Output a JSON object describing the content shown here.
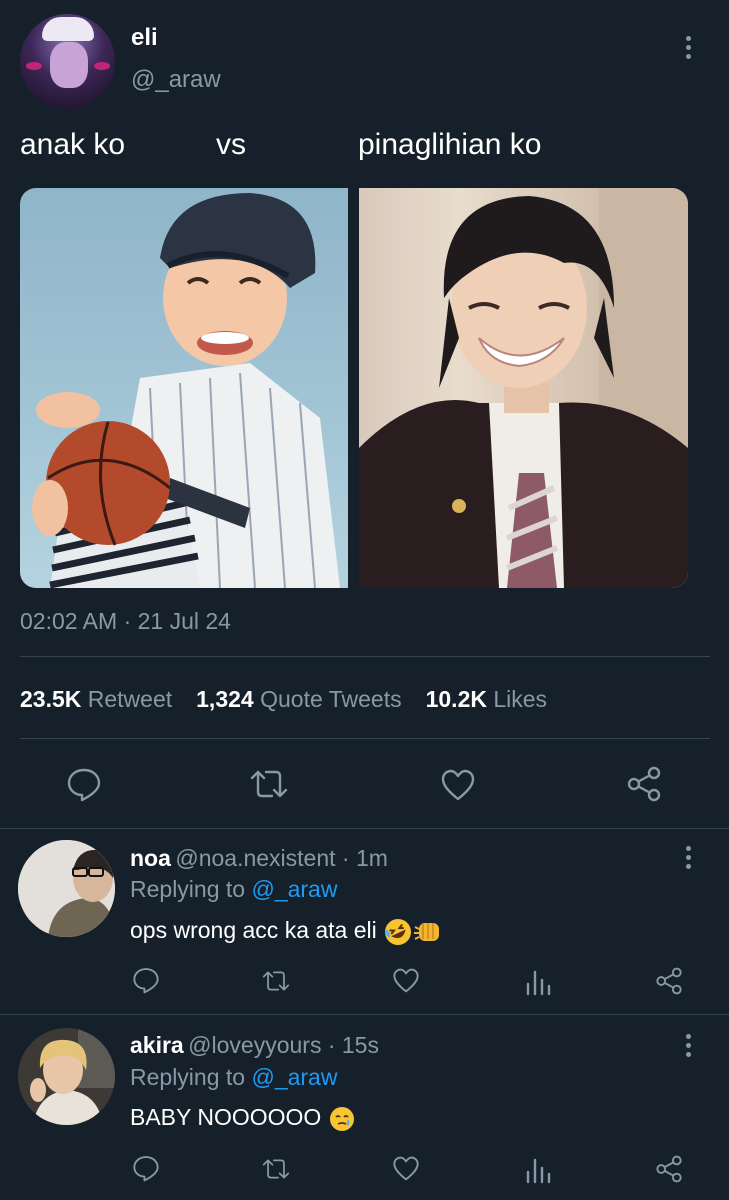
{
  "tweet": {
    "name": "eli",
    "handle": "@_araw",
    "text_left": "anak ko",
    "text_mid": "vs",
    "text_right": "pinaglihian ko",
    "timestamp": "02:02 AM · 21 Jul 24",
    "stats": {
      "retweets_count": "23.5K",
      "retweets_label": "Retweet",
      "quotes_count": "1,324",
      "quotes_label": "Quote Tweets",
      "likes_count": "10.2K",
      "likes_label": "Likes"
    }
  },
  "replies": [
    {
      "name": "noa",
      "meta": "@noa.nexistent · 1m",
      "replying_prefix": "Replying to ",
      "replying_to": "@_araw",
      "text": "ops wrong acc ka ata eli",
      "emojis": [
        "rofl-emoji",
        "fist-bump-emoji"
      ]
    },
    {
      "name": "akira",
      "meta": "@loveyyours · 15s",
      "replying_prefix": "Replying to ",
      "replying_to": "@_araw",
      "text": "BABY NOOOOOO",
      "emojis": [
        "holding-back-tears-emoji"
      ]
    }
  ],
  "colors": {
    "background": "#16202b",
    "text_secondary": "#8899a6",
    "mention": "#1d9bf0",
    "divider": "#38444d"
  }
}
